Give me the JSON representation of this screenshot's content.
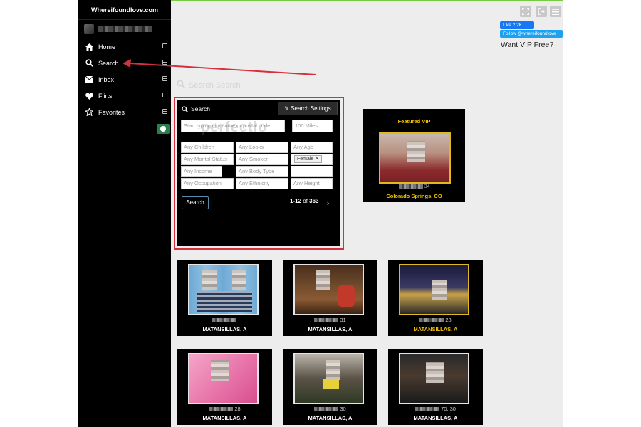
{
  "brand": "Whereifoundlove.com",
  "nav": [
    {
      "label": "Home",
      "icon": "home-icon"
    },
    {
      "label": "Search",
      "icon": "search-icon"
    },
    {
      "label": "Inbox",
      "icon": "inbox-icon"
    },
    {
      "label": "Flirts",
      "icon": "heart-icon"
    },
    {
      "label": "Favorites",
      "icon": "star-icon"
    }
  ],
  "social": {
    "fb_like": "Like 2.2K",
    "tw_follow": "Follow @whereifoundlove"
  },
  "vip_link": "Want VIP Free?",
  "ghost_heading": "Search Search",
  "watermark": "perfectlo",
  "search": {
    "title": "Search",
    "settings_label": "Search Settings",
    "keyword_placeholder": "Start typing city name or postal code",
    "distance_placeholder": "100 Miles",
    "fields": {
      "children": "Any Children",
      "looks": "Any Looks",
      "age": "Any Age",
      "marital": "Any Marital Status",
      "smoker": "Any Smoker",
      "income": "Any Income",
      "body": "Any Body Type",
      "occupation": "Any Occupation",
      "ethnicity": "Any Ethnicity",
      "height": "Any Height"
    },
    "gender_chip": "Female ✕",
    "button": "Search",
    "pager_range": "1-12",
    "pager_of": "of",
    "pager_total": "363",
    "pager_next": "›"
  },
  "featured": {
    "label": "Featured VIP",
    "name_suffix": "34",
    "location": "Colorado Springs, CO"
  },
  "cards": [
    {
      "age": "",
      "location": "MATANSILLAS, A",
      "vip": false
    },
    {
      "age": "31",
      "location": "MATANSILLAS, A",
      "vip": false
    },
    {
      "age": "28",
      "location": "MATANSILLAS, A",
      "vip": true
    },
    {
      "age": "28",
      "location": "MATANSILLAS, A",
      "vip": false
    },
    {
      "age": "30",
      "location": "MATANSILLAS, A",
      "vip": false
    },
    {
      "age": "70, 30",
      "location": "MATANSILLAS, A",
      "vip": false
    }
  ],
  "colors": {
    "accent_red": "#d62f3d",
    "vip_gold": "#f2c200",
    "facebook": "#1877f2",
    "twitter": "#1da1f2"
  }
}
